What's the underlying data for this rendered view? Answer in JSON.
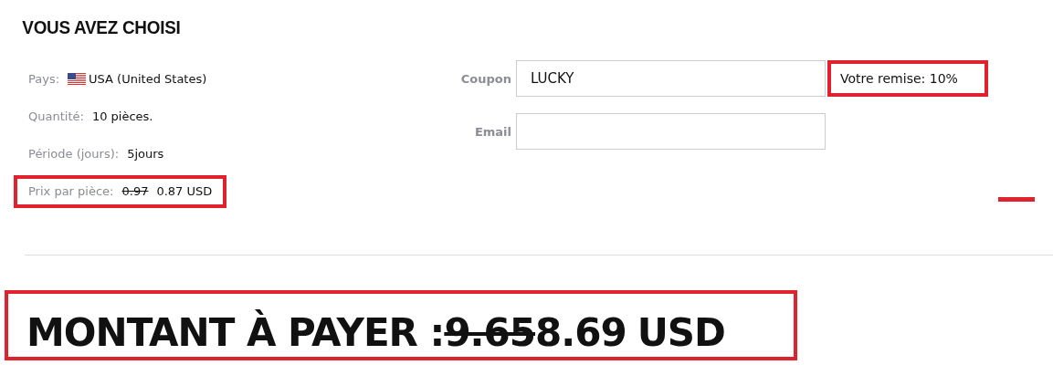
{
  "heading": "VOUS AVEZ CHOISI",
  "details": [
    {
      "kind": "country",
      "label": "Pays:",
      "value": "USA (United States)",
      "highlighted": false
    },
    {
      "kind": "plain",
      "label": "Quantité:",
      "value": "10 pièces.",
      "highlighted": false
    },
    {
      "kind": "plain",
      "label": "Période (jours):",
      "value": "5jours",
      "highlighted": false
    },
    {
      "kind": "price",
      "label": "Prix par pièce:",
      "old_value": "0.97",
      "value": "0.87 USD",
      "highlighted": true
    }
  ],
  "coupon": {
    "label": "Coupon",
    "value": "LUCKY"
  },
  "email": {
    "label": "Email"
  },
  "discount": {
    "text": "Votre remise: 10%",
    "highlighted": true
  },
  "total": {
    "label": "MONTANT À PAYER :",
    "old_amount": "9.65",
    "amount": "8.69",
    "currency": "USD",
    "highlighted": true
  }
}
